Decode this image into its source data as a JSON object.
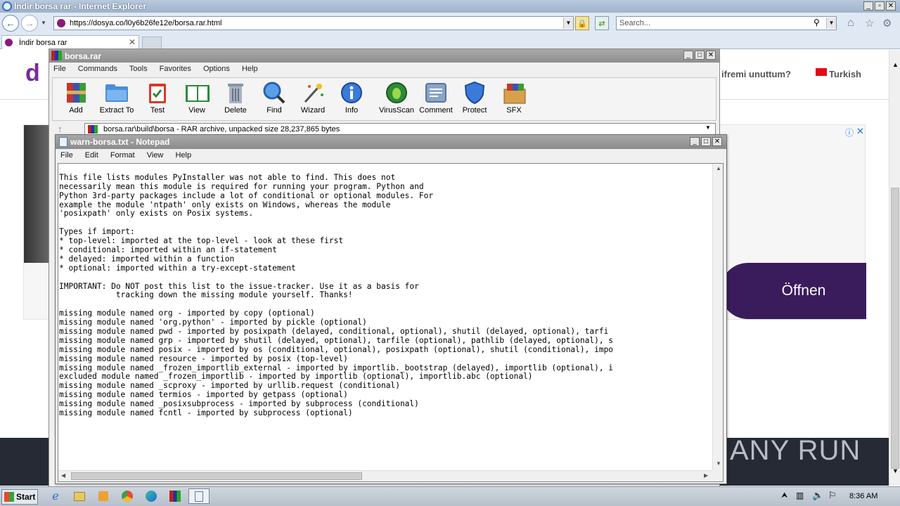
{
  "browser": {
    "title": "İndir borsa rar - Internet Explorer",
    "url": "https://dosya.co/l0y6b26fe12e/borsa.rar.html",
    "search_placeholder": "Search...",
    "tab_label": "İndir borsa rar"
  },
  "website": {
    "forgot": "ifremi unuttum?",
    "language": "Turkish",
    "open_button": "Öffnen"
  },
  "winrar": {
    "title": "borsa.rar",
    "menu": [
      "File",
      "Commands",
      "Tools",
      "Favorites",
      "Options",
      "Help"
    ],
    "toolbar": [
      {
        "label": "Add",
        "icon": "add-archive-icon"
      },
      {
        "label": "Extract To",
        "icon": "extract-folder-icon"
      },
      {
        "label": "Test",
        "icon": "test-clipboard-icon"
      },
      {
        "label": "View",
        "icon": "view-book-icon"
      },
      {
        "label": "Delete",
        "icon": "delete-trash-icon"
      },
      {
        "label": "Find",
        "icon": "find-magnifier-icon"
      },
      {
        "label": "Wizard",
        "icon": "wizard-wand-icon"
      },
      {
        "label": "Info",
        "icon": "info-icon"
      },
      {
        "label": "VirusScan",
        "icon": "virusscan-bug-icon"
      },
      {
        "label": "Comment",
        "icon": "comment-icon"
      },
      {
        "label": "Protect",
        "icon": "protect-shield-icon"
      },
      {
        "label": "SFX",
        "icon": "sfx-box-icon"
      }
    ],
    "path": "borsa.rar\\build\\borsa - RAR archive, unpacked size 28,237,865 bytes"
  },
  "notepad": {
    "title": "warn-borsa.txt - Notepad",
    "menu": [
      "File",
      "Edit",
      "Format",
      "View",
      "Help"
    ],
    "lines": [
      "",
      "This file lists modules PyInstaller was not able to find. This does not",
      "necessarily mean this module is required for running your program. Python and",
      "Python 3rd-party packages include a lot of conditional or optional modules. For",
      "example the module 'ntpath' only exists on Windows, whereas the module",
      "'posixpath' only exists on Posix systems.",
      "",
      "Types if import:",
      "* top-level: imported at the top-level - look at these first",
      "* conditional: imported within an if-statement",
      "* delayed: imported within a function",
      "* optional: imported within a try-except-statement",
      "",
      "IMPORTANT: Do NOT post this list to the issue-tracker. Use it as a basis for",
      "            tracking down the missing module yourself. Thanks!",
      "",
      "missing module named org - imported by copy (optional)",
      "missing module named 'org.python' - imported by pickle (optional)",
      "missing module named pwd - imported by posixpath (delayed, conditional, optional), shutil (delayed, optional), tarfi",
      "missing module named grp - imported by shutil (delayed, optional), tarfile (optional), pathlib (delayed, optional), s",
      "missing module named posix - imported by os (conditional, optional), posixpath (optional), shutil (conditional), impo",
      "missing module named resource - imported by posix (top-level)",
      "missing module named _frozen_importlib_external - imported by importlib._bootstrap (delayed), importlib (optional), i",
      "excluded module named _frozen_importlib - imported by importlib (optional), importlib.abc (optional)",
      "missing module named _scproxy - imported by urllib.request (conditional)",
      "missing module named termios - imported by getpass (optional)",
      "missing module named _posixsubprocess - imported by subprocess (conditional)",
      "missing module named fcntl - imported by subprocess (optional)"
    ]
  },
  "taskbar": {
    "start": "Start",
    "time": "8:36 AM"
  },
  "watermark": "ANY RUN"
}
